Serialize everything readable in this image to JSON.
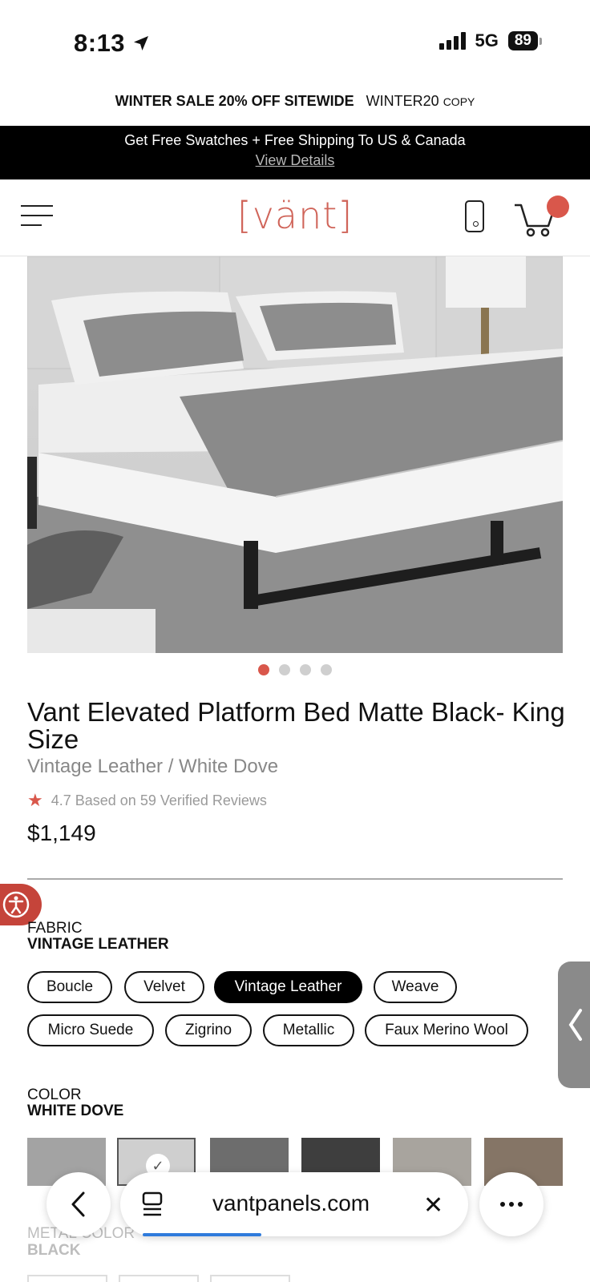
{
  "status": {
    "time": "8:13",
    "network": "5G",
    "battery": "89"
  },
  "promo": {
    "headline": "WINTER SALE 20% OFF SITEWIDE",
    "code": "WINTER20",
    "copy": "COPY"
  },
  "shipping": {
    "text": "Get Free Swatches + Free Shipping To US & Canada",
    "link": "View Details"
  },
  "header": {
    "logo": "[vänt]"
  },
  "product": {
    "title": "Vant Elevated Platform Bed Matte Black- King Size",
    "subtitle": "Vintage Leather / White Dove",
    "rating": "4.7 Based on 59 Verified Reviews",
    "price": "$1,149",
    "image_count": 4,
    "active_image": 1
  },
  "fabric": {
    "label": "FABRIC",
    "value": "VINTAGE LEATHER",
    "options": [
      "Boucle",
      "Velvet",
      "Vintage Leather",
      "Weave",
      "Micro Suede",
      "Zigrino",
      "Metallic",
      "Faux Merino Wool"
    ],
    "selected": "Vintage Leather"
  },
  "color": {
    "label": "COLOR",
    "value": "WHITE DOVE",
    "swatches": [
      "#a3a3a3",
      "#cfcfcf",
      "#6d6d6d",
      "#3e3e3e",
      "#a8a49e",
      "#857566"
    ],
    "selected_index": 1
  },
  "metal": {
    "label": "METAL COLOR",
    "value": "BLACK"
  },
  "browser": {
    "url": "vantpanels.com"
  },
  "colors": {
    "accent": "#d9574b",
    "access": "#c5443a",
    "link_blue": "#2f7bdc"
  }
}
